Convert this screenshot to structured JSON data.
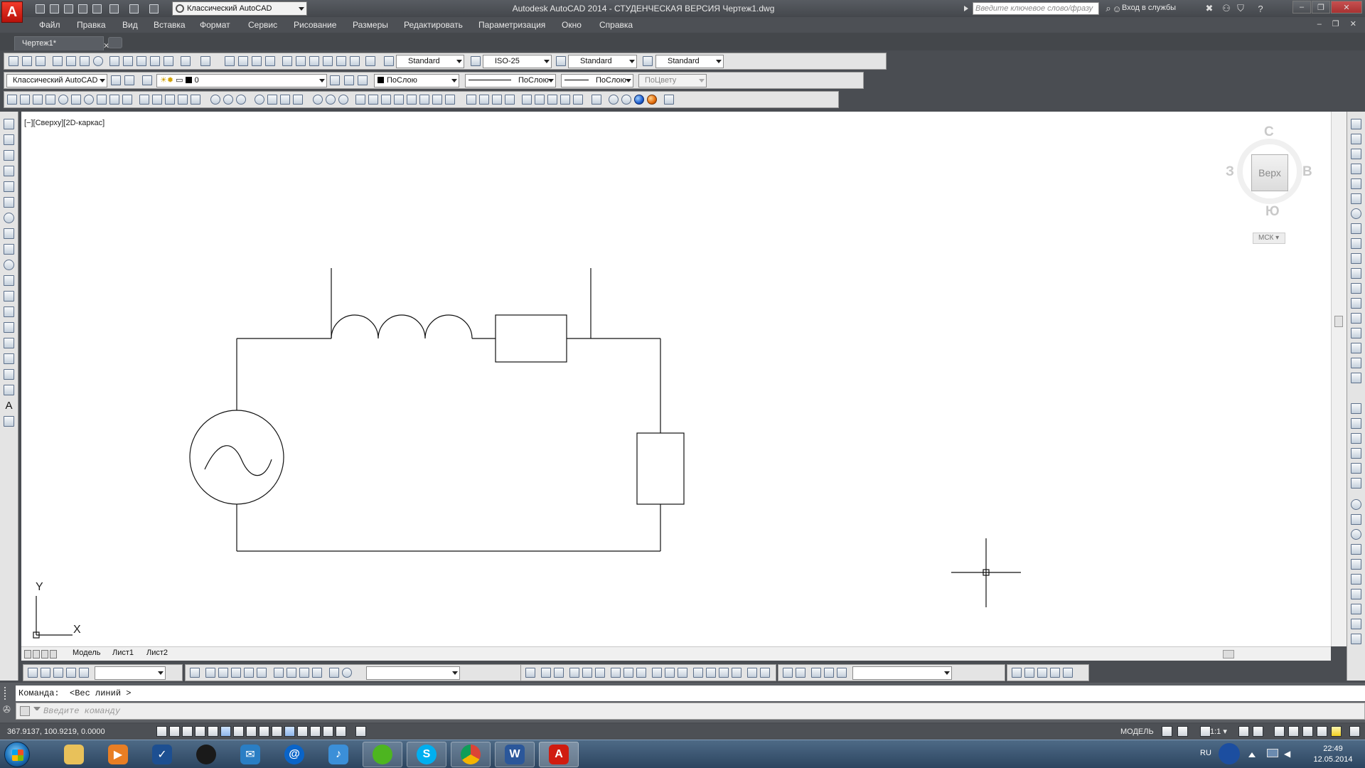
{
  "app": {
    "logo": "A",
    "title": "Autodesk AutoCAD 2014 - СТУДЕНЧЕСКАЯ ВЕРСИЯ    Чертеж1.dwg",
    "workspace": "Классический AutoCAD",
    "search_placeholder": "Введите ключевое слово/фразу",
    "signin": "Вход в службы",
    "help": "?",
    "minimize": "–",
    "restore": "❐",
    "close": "✕"
  },
  "menu": {
    "items": [
      "Файл",
      "Правка",
      "Вид",
      "Вставка",
      "Формат",
      "Сервис",
      "Рисование",
      "Размеры",
      "Редактировать",
      "Параметризация",
      "Окно",
      "Справка"
    ],
    "mdi_controls": "– ❐ ✕"
  },
  "tabs": {
    "doc": "Чертеж1*",
    "close": "✕"
  },
  "toolbar1": {
    "text_style": "Standard",
    "dim_style": "ISO-25",
    "table_style": "Standard",
    "mleader_style": "Standard"
  },
  "toolbar2": {
    "workspace": "Классический AutoCAD",
    "layer": "0",
    "color": "ПоСлою",
    "linetype": "ПоСлою",
    "lineweight": "ПоСлою",
    "plotstyle": "ПоЦвету"
  },
  "viewport": {
    "label": "[−][Сверху][2D-каркас]"
  },
  "viewcube": {
    "north": "С",
    "south": "Ю",
    "east": "В",
    "west": "З",
    "face": "Верх",
    "ucs": "МСК ▾"
  },
  "ucs_icon": {
    "x": "X",
    "y": "Y"
  },
  "layout_tabs": [
    "Модель",
    "Лист1",
    "Лист2"
  ],
  "command": {
    "history": "Команда:  <Вес линий >",
    "placeholder": "Введите команду"
  },
  "status": {
    "coords": "367.9137, 100.9219, 0.0000",
    "space": "МОДЕЛЬ",
    "scale": "1:1 ▾"
  },
  "taskbar": {
    "lang": "RU",
    "time": "22:49",
    "date": "12.05.2014",
    "word": "W",
    "autocad": "A"
  },
  "colors": {
    "chrome_dark": "#4a4d52",
    "toolbar_bg": "#e4e4e4",
    "canvas": "#ffffff",
    "autocad_red": "#d01c10"
  }
}
